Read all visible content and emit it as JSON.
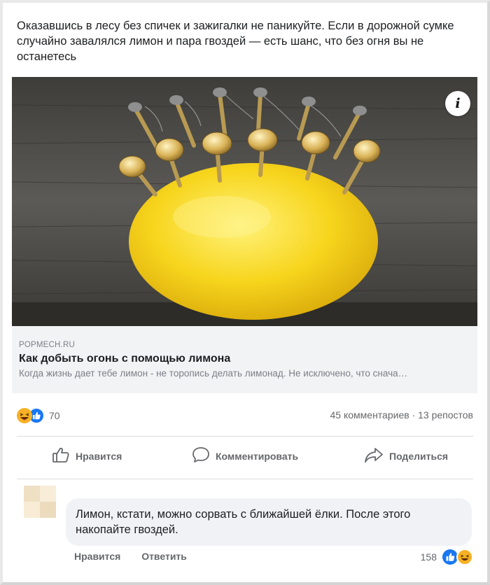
{
  "post": {
    "text": "Оказавшись в лесу без спичек и зажигалки не паникуйте. Если в дорожной сумке случайно завалялся лимон и пара гвоздей — есть шанс, что без огня вы не останетесь"
  },
  "media": {
    "info_glyph": "i",
    "colors": {
      "wood": "#54534f",
      "lemon": "#f6d41c",
      "nail": "#c9a54a"
    }
  },
  "link_preview": {
    "domain": "POPMECH.RU",
    "title": "Как добыть огонь с помощью лимона",
    "description": "Когда жизнь дает тебе лимон - не торопись делать лимонад. Не исключено, что снача…"
  },
  "stats": {
    "reaction_icons": [
      "haha-icon",
      "like-icon"
    ],
    "reaction_count": "70",
    "comments_and_reposts": "45 комментариев · 13 репостов"
  },
  "actions": {
    "like": "Нравится",
    "comment": "Комментировать",
    "share": "Поделиться"
  },
  "comment": {
    "text": "Лимон, кстати, можно сорвать с ближайшей ёлки. После этого накопайте гвоздей.",
    "like_label": "Нравится",
    "reply_label": "Ответить",
    "reaction_count": "158"
  },
  "colors": {
    "accent": "#1877f2",
    "muted_text": "#65676b",
    "bubble": "#f0f2f5"
  }
}
